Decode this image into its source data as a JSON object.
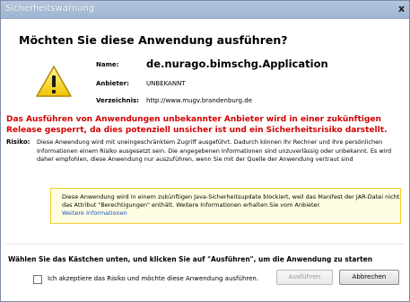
{
  "window": {
    "title": "Sicherheitswarnung",
    "close_glyph": "x"
  },
  "heading": "Möchten Sie diese Anwendung ausführen?",
  "info": {
    "name_label": "Name:",
    "name_value": "de.nurago.bimschg.Application",
    "publisher_label": "Anbieter:",
    "publisher_value": "UNBEKANNT",
    "location_label": "Verzeichnis:",
    "location_value": "http://www.mugv.brandenburg.de"
  },
  "warning": "Das Ausführen von Anwendungen unbekannter Anbieter wird in einer zukünftigen Release gesperrt, da dies potenziell unsicher ist und ein Sicherheitsrisiko darstellt.",
  "risk": {
    "label": "Risiko:",
    "text": "Diese Anwendung wird mit uneingeschränktem Zugriff ausgeführt. Dadurch können Ihr Rechner und Ihre persönlichen Informationen einem Risiko ausgesetzt sein. Die angegebenen Informationen sind unzuverlässig oder unbekannt. Es wird daher empfohlen, diese Anwendung nur auszuführen, wenn Sie mit der Quelle der Anwendung vertraut sind"
  },
  "notice": {
    "text": "Diese Anwendung wird in einem zukünftigen Java-Sicherheitsupdate blockiert, weil das Manifest der JAR-Datei nicht das Attribut \"Berechtigungen\" enthält. Weitere Informationen erhalten Sie vom Anbieter.",
    "link": "Weitere Informationen"
  },
  "instruction": "Wählen Sie das Kästchen unten, und klicken Sie auf \"Ausführen\", um die Anwendung zu starten",
  "checkbox_label": "Ich akzeptiere das Risiko und möchte diese Anwendung ausführen.",
  "buttons": {
    "run": "Ausführen",
    "cancel": "Abbrechen"
  },
  "icon": "warning-triangle-icon",
  "colors": {
    "warning_text": "#d40000",
    "notice_background": "#fffde1",
    "notice_border": "#f2cc2e",
    "link": "#1a4fc7",
    "titlebar": "#a9bdd8"
  }
}
